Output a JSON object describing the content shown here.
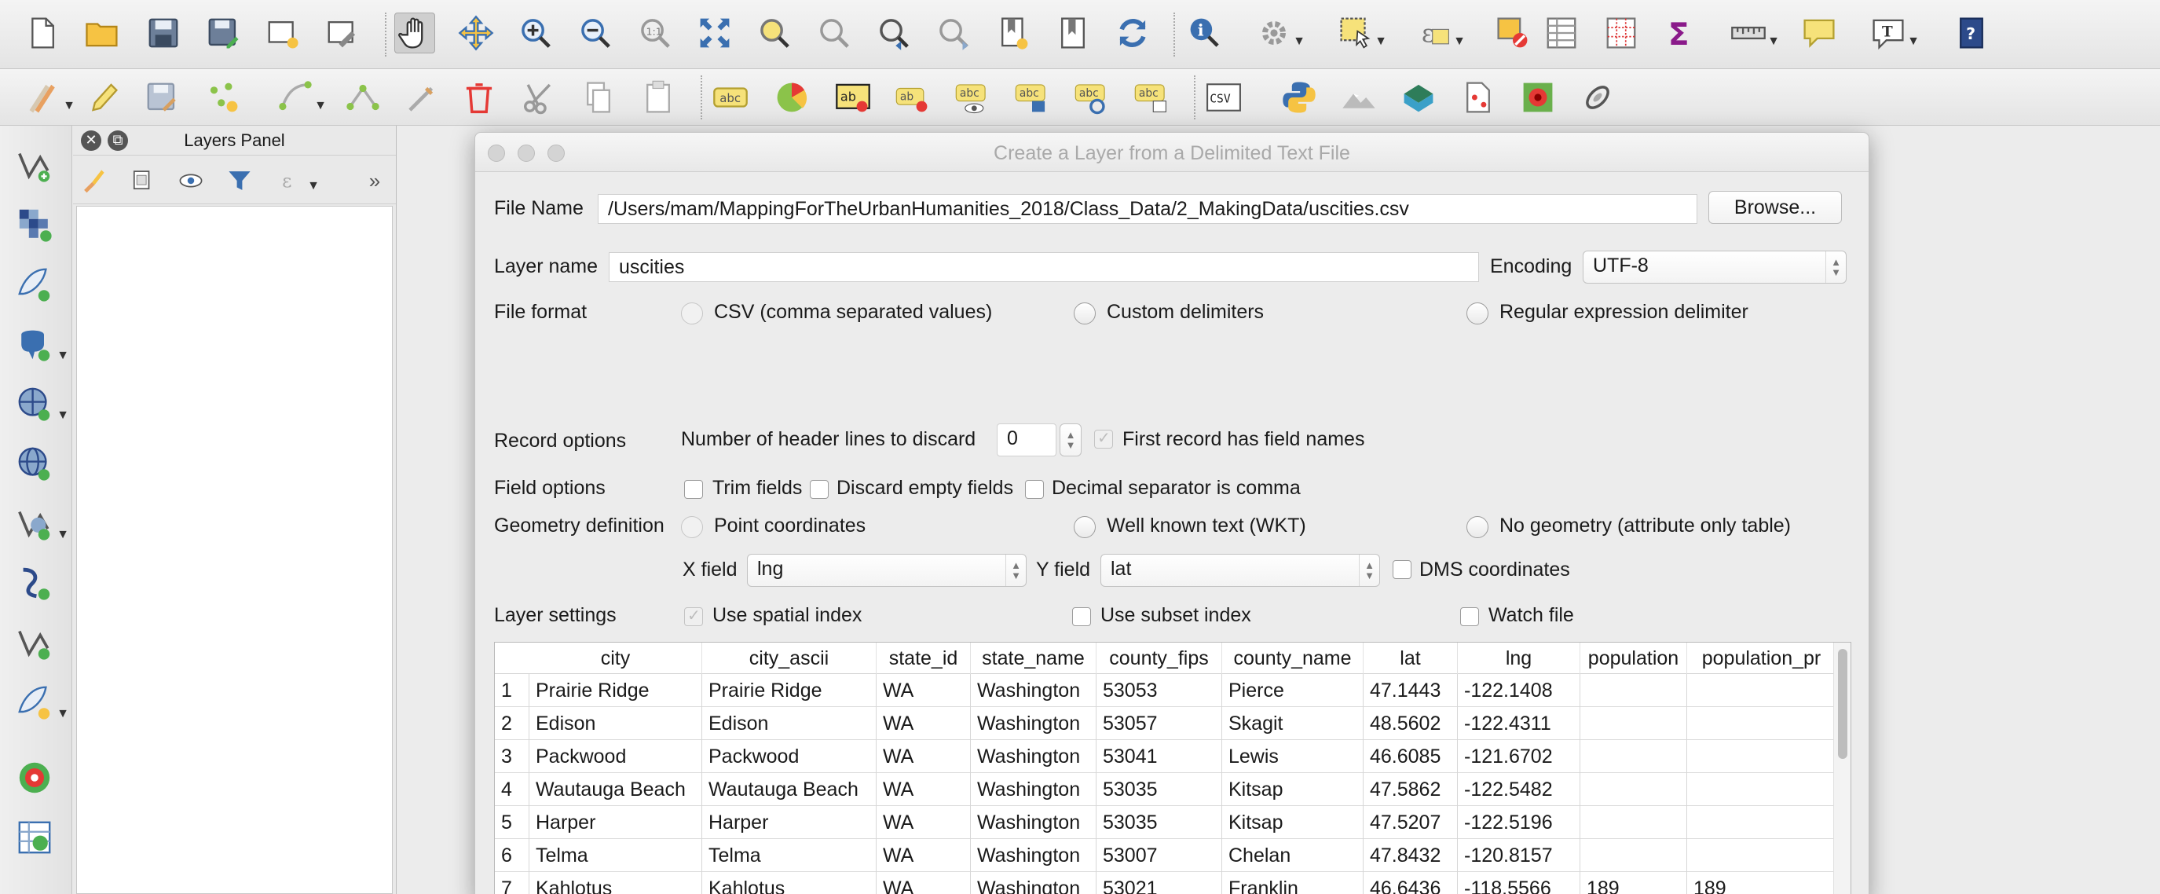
{
  "toolbar1": {
    "icons": [
      "new-project-icon",
      "open-project-icon",
      "save-project-icon",
      "save-as-icon",
      "new-print-composer-icon",
      "composer-manager-icon",
      "pan-icon",
      "pan-to-selection-icon",
      "zoom-in-icon",
      "zoom-out-icon",
      "zoom-native-icon",
      "zoom-full-icon",
      "zoom-to-selection-icon",
      "zoom-to-layer-icon",
      "zoom-last-icon",
      "zoom-next-icon",
      "new-bookmark-icon",
      "show-bookmarks-icon",
      "refresh-icon",
      "identify-icon",
      "select-feature-icon",
      "select-by-area-icon",
      "deselect-icon",
      "open-attribute-table-icon",
      "statistics-icon",
      "sum-icon",
      "measure-icon",
      "tooltip-icon",
      "text-annotation-icon",
      "help-icon"
    ]
  },
  "toolbar2": {
    "icons": [
      "current-edits-icon",
      "toggle-editing-icon",
      "save-edits-icon",
      "add-feature-icon",
      "move-feature-icon",
      "node-tool-icon",
      "digitize-icon",
      "delete-selected-icon",
      "cut-icon",
      "copy-icon",
      "paste-icon",
      "label-icon",
      "pie-chart-icon",
      "layer-labeling-icon",
      "pin-labels-icon",
      "show-hide-labels-icon",
      "move-label-icon",
      "rotate-label-icon",
      "change-label-icon",
      "add-delimited-text-icon",
      "python-icon",
      "terrain-icon",
      "globe-icon",
      "georeferencer-icon",
      "heatmap-icon",
      "gps-icon"
    ],
    "csv_label": "CSV"
  },
  "left_toolbar": {
    "icons": [
      "add-vector-layer-icon",
      "add-raster-layer-icon",
      "new-shapefile-icon",
      "add-postgis-icon",
      "add-spatialite-icon",
      "add-wms-icon",
      "add-wfs-icon",
      "add-mssql-icon",
      "add-oracle-icon",
      "new-spatialite-icon",
      "add-virtual-layer-icon",
      "add-gpx-icon"
    ]
  },
  "layers_panel": {
    "title": "Layers Panel"
  },
  "dialog": {
    "title": "Create a Layer from a Delimited Text File",
    "file_name_label": "File Name",
    "file_name_value": "/Users/mam/MappingForTheUrbanHumanities_2018/Class_Data/2_MakingData/uscities.csv",
    "browse_label": "Browse...",
    "layer_name_label": "Layer name",
    "layer_name_value": "uscities",
    "encoding_label": "Encoding",
    "encoding_value": "UTF-8",
    "file_format_label": "File format",
    "format_csv": "CSV (comma separated values)",
    "format_custom": "Custom delimiters",
    "format_regex": "Regular expression delimiter",
    "record_options_label": "Record options",
    "header_lines_label": "Number of header lines to discard",
    "header_lines_value": "0",
    "first_record_label": "First record has field names",
    "field_options_label": "Field options",
    "trim_fields_label": "Trim fields",
    "discard_empty_label": "Discard empty fields",
    "decimal_comma_label": "Decimal separator is comma",
    "geometry_label": "Geometry definition",
    "point_coords_label": "Point coordinates",
    "wkt_label": "Well known text (WKT)",
    "no_geometry_label": "No geometry (attribute only table)",
    "x_field_label": "X field",
    "x_field_value": "lng",
    "y_field_label": "Y field",
    "y_field_value": "lat",
    "dms_label": "DMS coordinates",
    "layer_settings_label": "Layer settings",
    "spatial_index_label": "Use spatial index",
    "subset_index_label": "Use subset index",
    "watch_file_label": "Watch file"
  },
  "table": {
    "columns": [
      "city",
      "city_ascii",
      "state_id",
      "state_name",
      "county_fips",
      "county_name",
      "lat",
      "lng",
      "population",
      "population_pr"
    ],
    "rows": [
      {
        "num": "1",
        "cells": [
          "Prairie Ridge",
          "Prairie Ridge",
          "WA",
          "Washington",
          "53053",
          "Pierce",
          "47.1443",
          "-122.1408",
          "",
          ""
        ]
      },
      {
        "num": "2",
        "cells": [
          "Edison",
          "Edison",
          "WA",
          "Washington",
          "53057",
          "Skagit",
          "48.5602",
          "-122.4311",
          "",
          ""
        ]
      },
      {
        "num": "3",
        "cells": [
          "Packwood",
          "Packwood",
          "WA",
          "Washington",
          "53041",
          "Lewis",
          "46.6085",
          "-121.6702",
          "",
          ""
        ]
      },
      {
        "num": "4",
        "cells": [
          "Wautauga Beach",
          "Wautauga Beach",
          "WA",
          "Washington",
          "53035",
          "Kitsap",
          "47.5862",
          "-122.5482",
          "",
          ""
        ]
      },
      {
        "num": "5",
        "cells": [
          "Harper",
          "Harper",
          "WA",
          "Washington",
          "53035",
          "Kitsap",
          "47.5207",
          "-122.5196",
          "",
          ""
        ]
      },
      {
        "num": "6",
        "cells": [
          "Telma",
          "Telma",
          "WA",
          "Washington",
          "53007",
          "Chelan",
          "47.8432",
          "-120.8157",
          "",
          ""
        ]
      },
      {
        "num": "7",
        "cells": [
          "Kahlotus",
          "Kahlotus",
          "WA",
          "Washington",
          "53021",
          "Franklin",
          "46.6436",
          "-118.5566",
          "189",
          "189"
        ]
      }
    ]
  }
}
